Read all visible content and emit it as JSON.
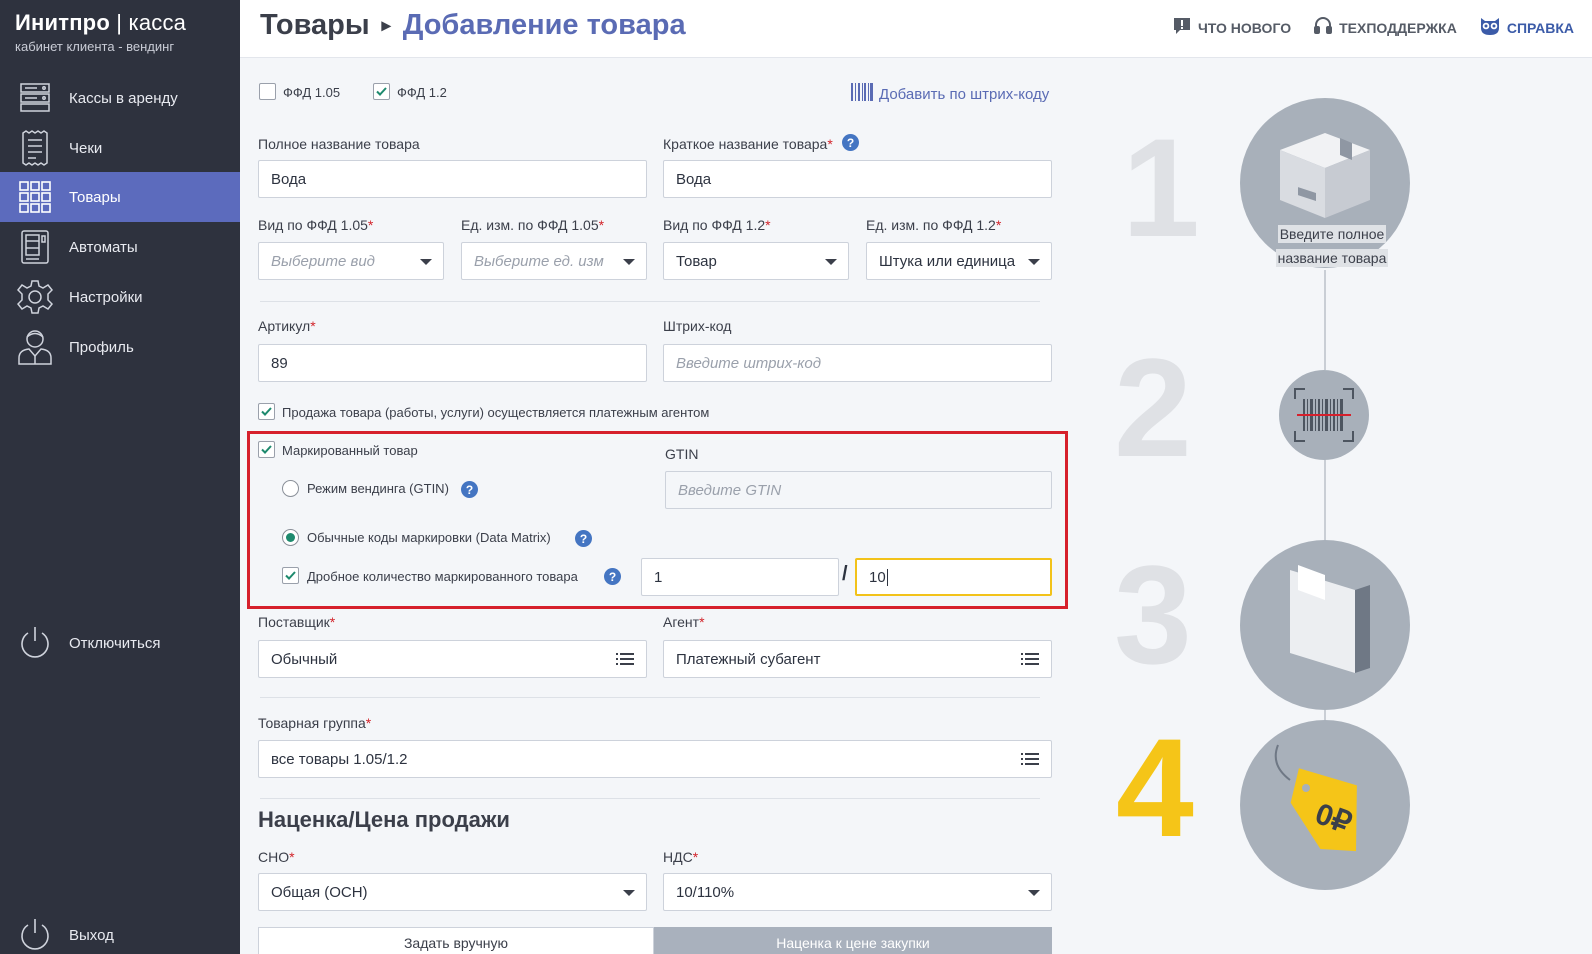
{
  "brand": {
    "title": "Инитпро",
    "title_suffix": "касса",
    "subtitle": "кабинет клиента - вендинг"
  },
  "sidebar": {
    "items": [
      {
        "label": "Кассы в аренду",
        "icon": "server-icon"
      },
      {
        "label": "Чеки",
        "icon": "receipt-icon"
      },
      {
        "label": "Товары",
        "icon": "grid-icon",
        "active": true
      },
      {
        "label": "Автоматы",
        "icon": "vending-machine-icon"
      },
      {
        "label": "Настройки",
        "icon": "gear-icon"
      },
      {
        "label": "Профиль",
        "icon": "user-icon"
      }
    ],
    "disconnect": "Отключиться",
    "logout": "Выход"
  },
  "header": {
    "crumb_parent": "Товары",
    "crumb_current": "Добавление товара",
    "links": {
      "news": "ЧТО НОВОГО",
      "support": "ТЕХПОДДЕРЖКА",
      "help": "СПРАВКА"
    }
  },
  "form": {
    "ffd105_label": "ФФД 1.05",
    "ffd12_label": "ФФД 1.2",
    "ffd105_checked": false,
    "ffd12_checked": true,
    "add_by_barcode": "Добавить по штрих-коду",
    "full_name_label": "Полное название товара",
    "full_name_value": "Вода",
    "short_name_label": "Краткое название товара",
    "short_name_value": "Вода",
    "kind105_label": "Вид по ФФД 1.05",
    "kind105_placeholder": "Выберите вид",
    "unit105_label": "Ед. изм. по ФФД 1.05",
    "unit105_placeholder": "Выберите ед. изм",
    "kind12_label": "Вид по ФФД 1.2",
    "kind12_value": "Товар",
    "unit12_label": "Ед. изм. по ФФД 1.2",
    "unit12_value": "Штука или единица",
    "article_label": "Артикул",
    "article_value": "89",
    "barcode_label": "Штрих-код",
    "barcode_placeholder": "Введите штрих-код",
    "agent_sale_label": "Продажа товара (работы, услуги) осуществляется платежным агентом",
    "marked_label": "Маркированный товар",
    "gtin_label": "GTIN",
    "gtin_placeholder": "Введите GTIN",
    "mode_vending_label": "Режим вендинга (GTIN)",
    "mode_datamatrix_label": "Обычные коды маркировки (Data Matrix)",
    "fraction_label": "Дробное количество маркированного товара",
    "fraction_num": "1",
    "fraction_sep": "/",
    "fraction_den": "10",
    "supplier_label": "Поставщик",
    "supplier_value": "Обычный",
    "agent_label": "Агент",
    "agent_value": "Платежный субагент",
    "group_label": "Товарная группа",
    "group_value": "все товары 1.05/1.2",
    "markup_title": "Наценка/Цена продажи",
    "sno_label": "СНО",
    "sno_value": "Общая (ОСН)",
    "nds_label": "НДС",
    "nds_value": "10/110%",
    "btn_manual": "Задать вручную",
    "btn_markup": "Наценка к цене закупки"
  },
  "steps": {
    "n1": "1",
    "n2": "2",
    "n3": "3",
    "n4": "4",
    "hint_line1": "Введите полное",
    "hint_line2": "название товара",
    "price_tag": "0₽",
    "active_color": "#f5c518"
  }
}
